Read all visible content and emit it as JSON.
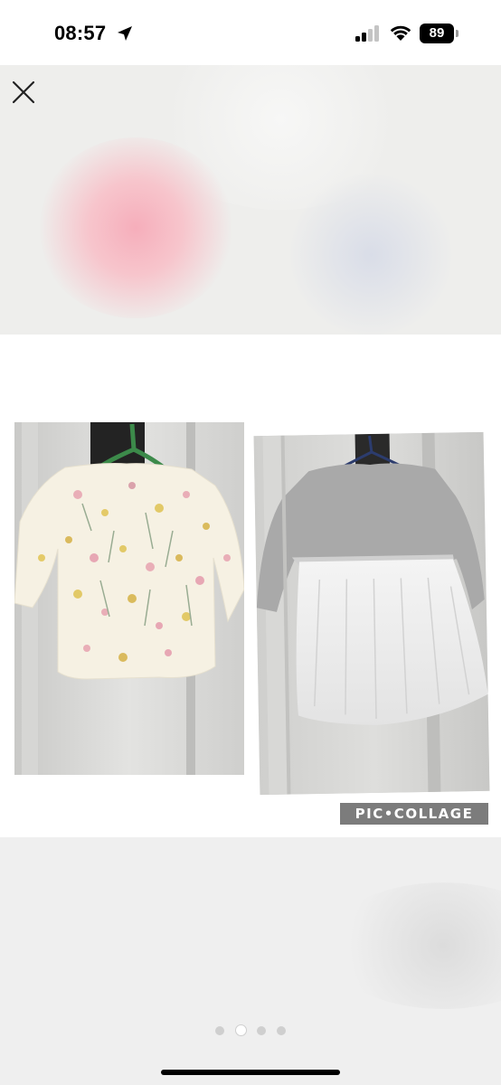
{
  "status_bar": {
    "time": "08:57",
    "battery_level": "89",
    "icons": [
      "location-arrow-icon",
      "signal-bars-icon",
      "wifi-icon",
      "battery-icon"
    ]
  },
  "viewer": {
    "close_icon": "close-icon",
    "photo_count": 4,
    "active_index": 1
  },
  "collage": {
    "watermark": "PIC•COLLAGE",
    "photos": [
      {
        "subject": "floral long-sleeve top on green hanger"
      },
      {
        "subject": "grey long-sleeve tutu dress on hanger"
      }
    ]
  },
  "colors": {
    "status_text": "#000000",
    "blur_bg": "#eeeeec",
    "watermark_bg": "#7c7c7c",
    "dot": "#cfcfcf"
  }
}
